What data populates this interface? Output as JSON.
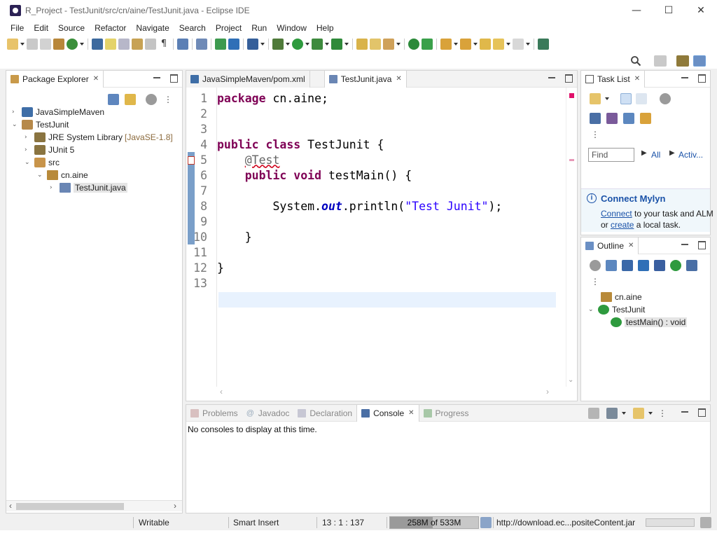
{
  "window": {
    "title": "R_Project - TestJunit/src/cn/aine/TestJunit.java - Eclipse IDE",
    "controls": {
      "minimize": "—",
      "maximize": "☐",
      "close": "✕"
    }
  },
  "menu": [
    "File",
    "Edit",
    "Source",
    "Refactor",
    "Navigate",
    "Search",
    "Project",
    "Run",
    "Window",
    "Help"
  ],
  "package_explorer": {
    "title": "Package Explorer",
    "tree": [
      {
        "label": "JavaSimpleMaven",
        "extra": "",
        "icon": "maven-project-icon",
        "expanded": false
      },
      {
        "label": "TestJunit",
        "extra": "",
        "icon": "java-project-error-icon",
        "expanded": true
      },
      {
        "label": "JRE System Library",
        "extra": "[JavaSE-1.8]",
        "icon": "library-icon",
        "expanded": false
      },
      {
        "label": "JUnit 5",
        "extra": "",
        "icon": "library-icon",
        "expanded": false
      },
      {
        "label": "src",
        "extra": "",
        "icon": "source-folder-error-icon",
        "expanded": true
      },
      {
        "label": "cn.aine",
        "extra": "",
        "icon": "package-error-icon",
        "expanded": true
      },
      {
        "label": "TestJunit.java",
        "extra": "",
        "icon": "java-file-error-icon",
        "expanded": false
      }
    ]
  },
  "editor": {
    "tabs": [
      {
        "label": "JavaSimpleMaven/pom.xml",
        "active": false
      },
      {
        "label": "TestJunit.java",
        "active": true
      }
    ],
    "line_numbers": [
      "1",
      "2",
      "3",
      "4",
      "5",
      "6",
      "7",
      "8",
      "9",
      "10",
      "11",
      "12",
      "13"
    ],
    "current_line": 13
  },
  "task_list": {
    "title": "Task List",
    "find_placeholder": "Find",
    "filter_all": "All",
    "filter_activate": "Activ...",
    "mylyn_title": "Connect Mylyn",
    "mylyn_line1_link": "Connect",
    "mylyn_line1_rest": " to your task and ALM",
    "mylyn_line2_pre": "or ",
    "mylyn_line2_link": "create",
    "mylyn_line2_rest": " a local task."
  },
  "outline": {
    "title": "Outline",
    "items": [
      {
        "label": "cn.aine"
      },
      {
        "label": "TestJunit"
      },
      {
        "label": "testMain() : void"
      }
    ]
  },
  "bottom_panel": {
    "tabs": [
      {
        "label": "Problems",
        "active": false
      },
      {
        "label": "Javadoc",
        "active": false
      },
      {
        "label": "Declaration",
        "active": false
      },
      {
        "label": "Console",
        "active": true
      },
      {
        "label": "Progress",
        "active": false
      }
    ],
    "message": "No consoles to display at this time."
  },
  "status": {
    "writable": "Writable",
    "insert_mode": "Smart Insert",
    "position": "13 : 1 : 137",
    "heap": "258M of 533M",
    "heap_used_fraction": 0.484,
    "download": "http://download.ec...positeContent.jar"
  }
}
